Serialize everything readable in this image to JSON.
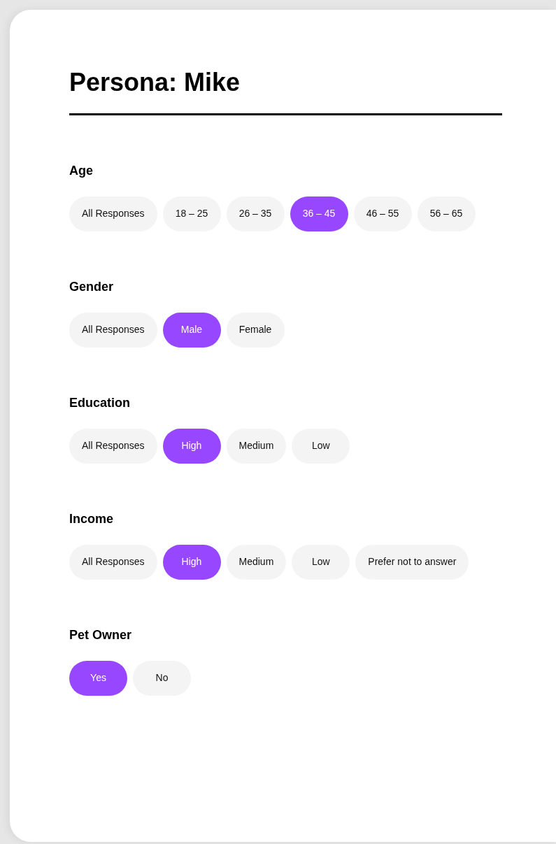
{
  "title": "Persona: Mike",
  "filters": [
    {
      "label": "Age",
      "options": [
        {
          "label": "All Responses",
          "selected": false
        },
        {
          "label": "18 – 25",
          "selected": false
        },
        {
          "label": "26 – 35",
          "selected": false
        },
        {
          "label": "36 – 45",
          "selected": true
        },
        {
          "label": "46 – 55",
          "selected": false
        },
        {
          "label": "56 – 65",
          "selected": false
        }
      ]
    },
    {
      "label": "Gender",
      "options": [
        {
          "label": "All Responses",
          "selected": false
        },
        {
          "label": "Male",
          "selected": true
        },
        {
          "label": "Female",
          "selected": false
        }
      ]
    },
    {
      "label": "Education",
      "options": [
        {
          "label": "All Responses",
          "selected": false
        },
        {
          "label": "High",
          "selected": true
        },
        {
          "label": "Medium",
          "selected": false
        },
        {
          "label": "Low",
          "selected": false
        }
      ]
    },
    {
      "label": "Income",
      "options": [
        {
          "label": "All Responses",
          "selected": false
        },
        {
          "label": "High",
          "selected": true
        },
        {
          "label": "Medium",
          "selected": false
        },
        {
          "label": "Low",
          "selected": false
        },
        {
          "label": "Prefer not to answer",
          "selected": false
        }
      ]
    },
    {
      "label": "Pet Owner",
      "options": [
        {
          "label": "Yes",
          "selected": true
        },
        {
          "label": "No",
          "selected": false
        }
      ]
    }
  ]
}
